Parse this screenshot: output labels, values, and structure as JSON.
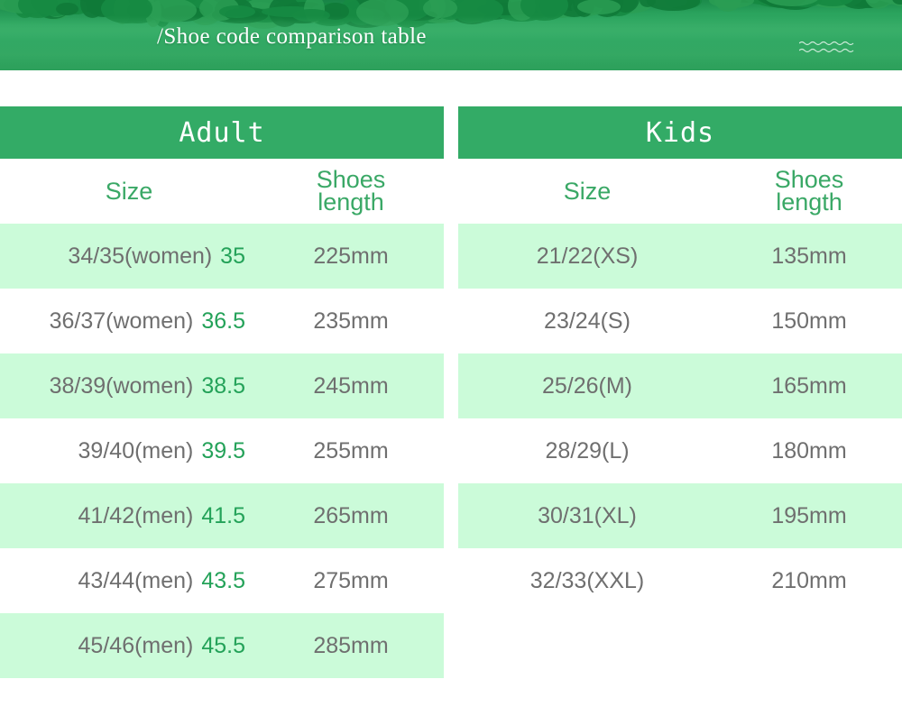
{
  "banner": {
    "title": "/Shoe code comparison table",
    "decoration": "wave-lines",
    "colors": {
      "green_dark": "#1c8d4c",
      "green_mid": "#33ab66",
      "green_light": "#2da05b"
    }
  },
  "theme": {
    "header_green": "#33ab66",
    "stripe_green": "#cbfbd9",
    "label_green": "#3aa866",
    "accent_green": "#24a259",
    "text_gray": "#6f6f6f",
    "white": "#ffffff"
  },
  "tables": [
    {
      "title": "Adult",
      "columns": {
        "size": "Size",
        "length_line1": "Shoes",
        "length_line2": "length"
      },
      "rows": [
        {
          "size": "34/35(women)",
          "alt": "35",
          "length": "225mm"
        },
        {
          "size": "36/37(women)",
          "alt": "36.5",
          "length": "235mm"
        },
        {
          "size": "38/39(women)",
          "alt": "38.5",
          "length": "245mm"
        },
        {
          "size": "39/40(men)",
          "alt": "39.5",
          "length": "255mm"
        },
        {
          "size": "41/42(men)",
          "alt": "41.5",
          "length": "265mm"
        },
        {
          "size": "43/44(men)",
          "alt": "43.5",
          "length": "275mm"
        },
        {
          "size": "45/46(men)",
          "alt": "45.5",
          "length": "285mm"
        }
      ]
    },
    {
      "title": "Kids",
      "columns": {
        "size": "Size",
        "length_line1": "Shoes",
        "length_line2": "length"
      },
      "rows": [
        {
          "size": "21/22(XS)",
          "alt": "",
          "length": "135mm"
        },
        {
          "size": "23/24(S)",
          "alt": "",
          "length": "150mm"
        },
        {
          "size": "25/26(M)",
          "alt": "",
          "length": "165mm"
        },
        {
          "size": "28/29(L)",
          "alt": "",
          "length": "180mm"
        },
        {
          "size": "30/31(XL)",
          "alt": "",
          "length": "195mm"
        },
        {
          "size": "32/33(XXL)",
          "alt": "",
          "length": "210mm"
        }
      ]
    }
  ]
}
